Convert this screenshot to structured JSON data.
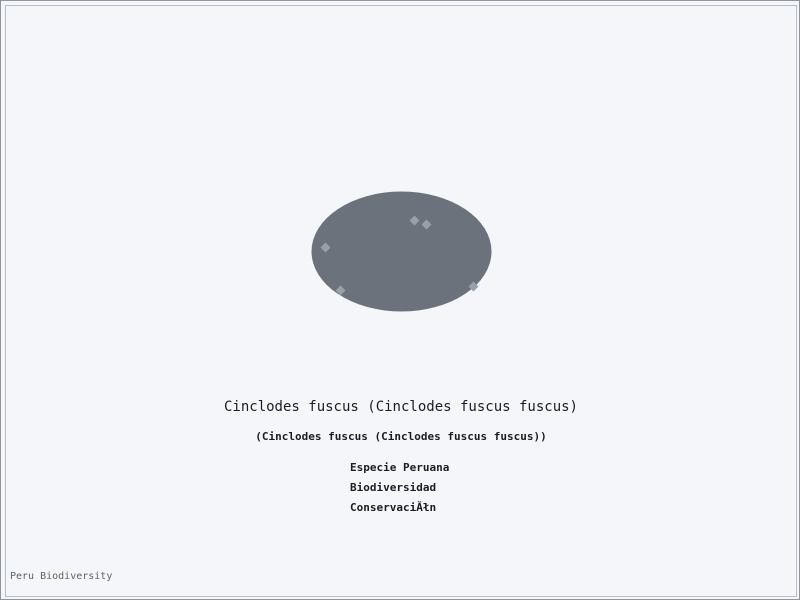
{
  "colors": {
    "background": "#f4f6f9",
    "specimen_fill": "#6c727c",
    "marker_fill": "#9aa0a8",
    "text": "#1b1d21",
    "footer_text": "#5d6470"
  },
  "species": {
    "title": "Cinclodes fuscus (Cinclodes fuscus fuscus)",
    "subtitle": "(Cinclodes fuscus (Cinclodes fuscus fuscus))",
    "specimen_shape": "ellipse",
    "marker_icon": "diamond-marker-icon"
  },
  "tags": [
    "Especie Peruana",
    "Biodiversidad",
    "ConservaciĂłn"
  ],
  "footer": {
    "credit": "Peru Biodiversity"
  }
}
